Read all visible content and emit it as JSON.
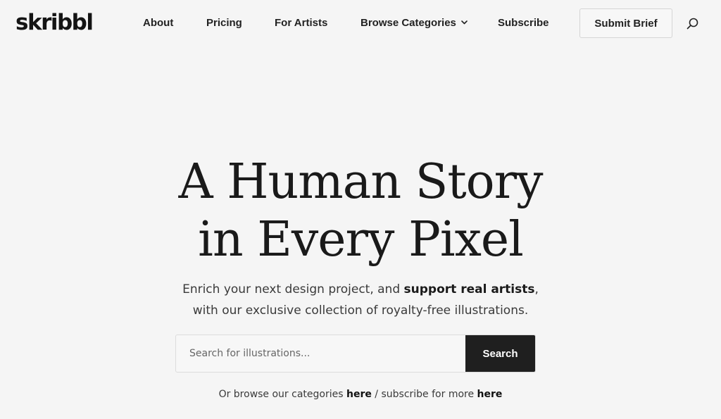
{
  "brand": {
    "logo_text": "skribbl"
  },
  "nav": {
    "about": "About",
    "pricing": "Pricing",
    "for_artists": "For Artists",
    "browse_categories": "Browse Categories",
    "subscribe": "Subscribe",
    "submit_brief": "Submit Brief",
    "search_icon": "search-icon",
    "dropdown_icon": "chevron-down-icon"
  },
  "hero": {
    "title_line1": "A Human Story",
    "title_line2": "in Every Pixel",
    "subtitle_part1": "Enrich your next design project, and ",
    "subtitle_bold": "support real artists",
    "subtitle_part2": ",",
    "subtitle_line2": "with our exclusive collection of royalty-free illustrations."
  },
  "search": {
    "placeholder": "Search for illustrations...",
    "value": "",
    "button_label": "Search"
  },
  "browse": {
    "prefix": "Or browse our categories ",
    "link1": "here",
    "middle": " / subscribe for more ",
    "link2": "here"
  },
  "colors": {
    "background": "#f5f5f5",
    "text": "#1b1b1b",
    "button_dark": "#1f1f1f",
    "button_text": "#ffffff",
    "border": "#d5d5d5"
  }
}
